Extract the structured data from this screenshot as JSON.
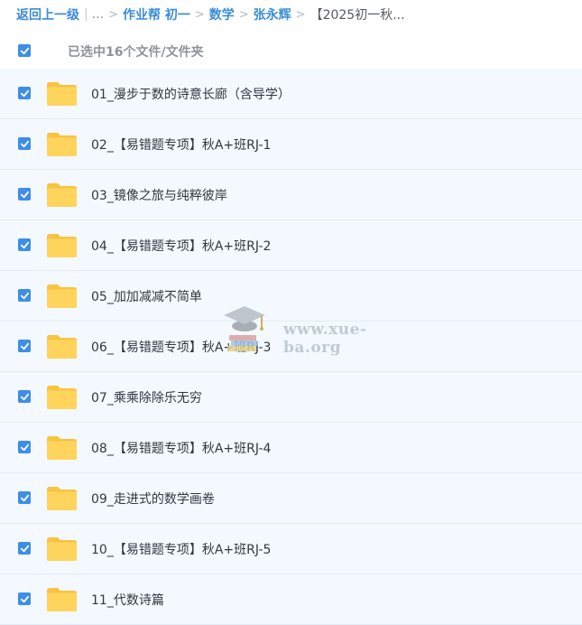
{
  "breadcrumb": {
    "back_label": "返回上一级",
    "ellipsis": "...",
    "items": [
      "作业帮 初一",
      "数学",
      "张永辉"
    ],
    "current": "【2025初一秋..."
  },
  "selection": {
    "label": "已选中16个文件/文件夹",
    "all_checked": true
  },
  "files": [
    {
      "name": "01_漫步于数的诗意长廊（含导学）",
      "checked": true,
      "icon": "folder-icon"
    },
    {
      "name": "02_【易错题专项】秋A+班RJ-1",
      "checked": true,
      "icon": "folder-icon"
    },
    {
      "name": "03_镜像之旅与纯粹彼岸",
      "checked": true,
      "icon": "folder-icon"
    },
    {
      "name": "04_【易错题专项】秋A+班RJ-2",
      "checked": true,
      "icon": "folder-icon"
    },
    {
      "name": "05_加加减减不简单",
      "checked": true,
      "icon": "folder-icon"
    },
    {
      "name": "06_【易错题专项】秋A+班RJ-3",
      "checked": true,
      "icon": "folder-icon"
    },
    {
      "name": "07_乘乘除除乐无穷",
      "checked": true,
      "icon": "folder-icon"
    },
    {
      "name": "08_【易错题专项】秋A+班RJ-4",
      "checked": true,
      "icon": "folder-icon"
    },
    {
      "name": "09_走进式的数学画卷",
      "checked": true,
      "icon": "folder-icon"
    },
    {
      "name": "10_【易错题专项】秋A+班RJ-5",
      "checked": true,
      "icon": "folder-icon"
    },
    {
      "name": "11_代数诗篇",
      "checked": true,
      "icon": "folder-icon"
    }
  ],
  "watermark": {
    "text": "www.xue-ba.org"
  },
  "colors": {
    "accent": "#3b8cd9",
    "checkbox": "#3d8ee6",
    "row_bg": "#f3f9fe",
    "folder": "#ffd25a"
  }
}
